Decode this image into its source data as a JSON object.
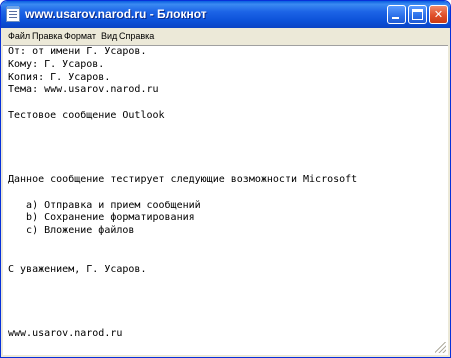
{
  "window": {
    "title": "www.usarov.narod.ru - Блокнот"
  },
  "menu": [
    {
      "label": "Файл"
    },
    {
      "label": "Правка"
    },
    {
      "label": "Формат"
    },
    {
      "label": "Вид"
    },
    {
      "label": "Справка"
    }
  ],
  "editor": {
    "text": "От: от имени Г. Усаров.\nКому: Г. Усаров.\nКопия: Г. Усаров.\nТема: www.usarov.narod.ru\n\nТестовое сообщение Outlook\n\n\n\n\nДанное сообщение тестирует следующие возможности Microsoft\n\n   a) Отправка и прием сообщений\n   b) Сохранение форматирования\n   c) Вложение файлов\n\n\nС уважением, Г. Усаров.\n\n\n\n\nwww.usarov.narod.ru"
  },
  "icons": {
    "app": "notepad-icon",
    "minimize": "minimize-icon",
    "maximize": "maximize-icon",
    "close": "close-icon",
    "resize": "resize-grip-icon"
  },
  "colors": {
    "titlebar": "#0b50d8",
    "close_button": "#e0502a",
    "chrome": "#ece9d8"
  }
}
